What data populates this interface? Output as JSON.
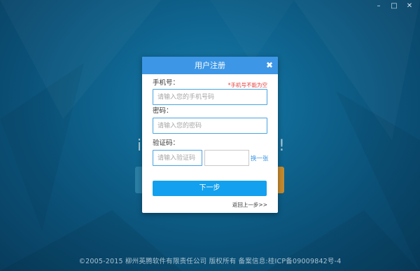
{
  "window": {
    "minimize_label": "–",
    "maximize_label": "□",
    "close_label": "✕"
  },
  "background": {
    "ghost_left": "i",
    "ghost_right": "!"
  },
  "dialog": {
    "title": "用户注册",
    "close_label": "✖",
    "phone": {
      "label": "手机号：",
      "error": "*手机号不能为空",
      "placeholder": "请输入您的手机号码",
      "value": ""
    },
    "password": {
      "label": "密码：",
      "placeholder": "请输入您的密码",
      "value": ""
    },
    "captcha": {
      "label": "验证码：",
      "placeholder": "请输入验证码",
      "value": "",
      "refresh_label": "换一张"
    },
    "next_label": "下一步",
    "back_label": "返回上一步>>"
  },
  "footer": {
    "text": "©2005-2015   柳州英腾软件有限责任公司   版权所有   备案信息:桂ICP备09009842号-4"
  },
  "colors": {
    "header": "#3d97e6",
    "primary_button": "#13a0ee",
    "error": "#e83a3a",
    "input_border": "#4aa3e0",
    "background": "#0f6893"
  }
}
